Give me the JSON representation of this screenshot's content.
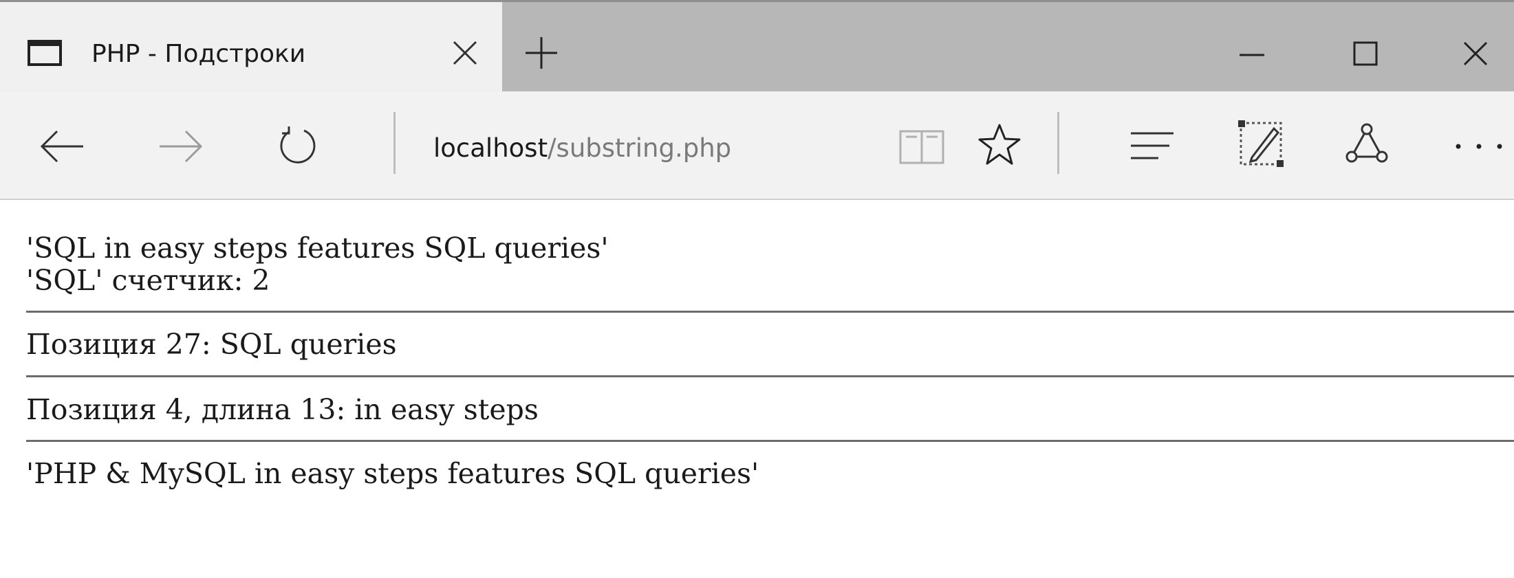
{
  "browser": {
    "tab": {
      "title": "PHP - Подстроки",
      "icon": "page-icon"
    },
    "address": {
      "host": "localhost",
      "path": "/substring.php"
    },
    "icons": {
      "close_tab": "close-icon",
      "new_tab": "plus-icon",
      "minimize": "minimize-icon",
      "maximize": "maximize-icon",
      "close_window": "close-icon",
      "back": "back-arrow-icon",
      "forward": "forward-arrow-icon",
      "refresh": "refresh-icon",
      "reading_view": "book-icon",
      "favorite": "star-icon",
      "hub": "hub-icon",
      "web_note": "pen-icon",
      "share": "share-icon",
      "more": "more-dots-icon"
    },
    "colors": {
      "titlebar": "#b7b7b7",
      "active_tab": "#f0f0f0",
      "navbar": "#f2f2f2"
    }
  },
  "page": {
    "lines": [
      "'SQL in easy steps features SQL queries'",
      "'SQL' счетчик: 2",
      "Позиция 27: SQL queries",
      "Позиция 4, длина 13: in easy steps",
      "'PHP & MySQL in easy steps features SQL queries'"
    ]
  }
}
